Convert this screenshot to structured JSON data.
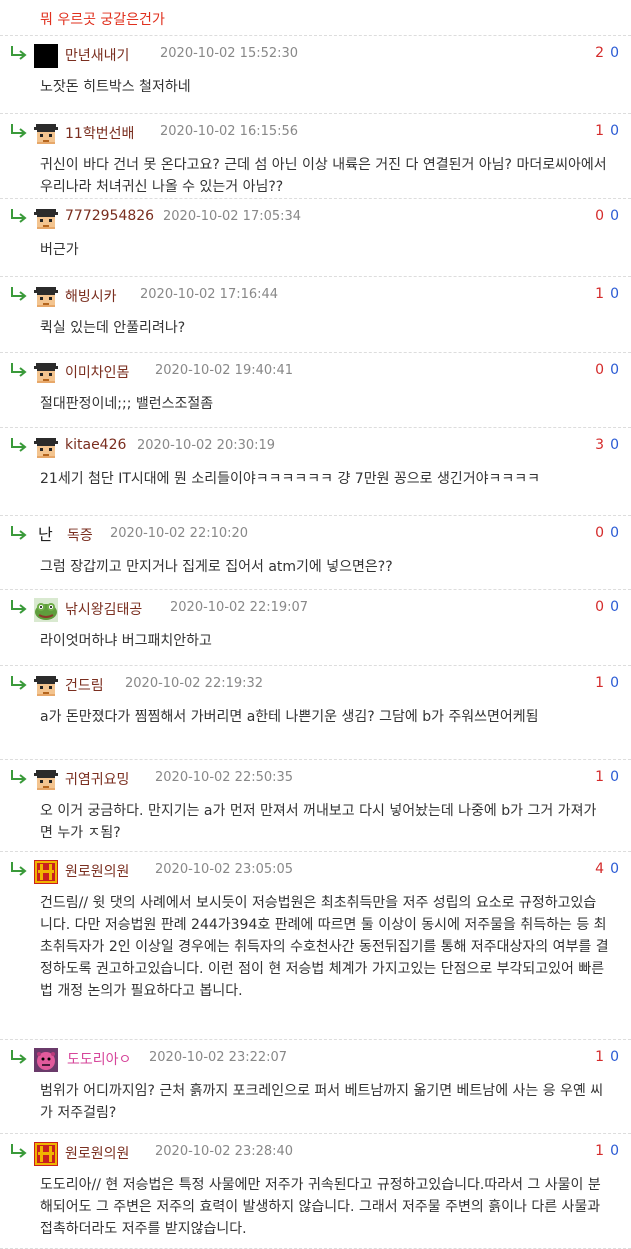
{
  "top_text": "뭐 우르곳 궁갈은건가",
  "comments": [
    {
      "nick": "만년새내기",
      "date": "2020-10-02 15:52:30",
      "up": "2",
      "down": "0",
      "avatar": "black",
      "text": "노잣돈 히트박스 철저하네"
    },
    {
      "nick": "11학번선배",
      "date": "2020-10-02 16:15:56",
      "up": "1",
      "down": "0",
      "avatar": "pixel-face",
      "text": "귀신이 바다 건너 못 온다고요? 근데 섬 아닌 이상 내륙은 거진 다 연결된거 아님? 마더로씨아에서 우리나라 처녀귀신 나올 수 있는거 아님??"
    },
    {
      "nick": "7772954826",
      "date": "2020-10-02 17:05:34",
      "up": "0",
      "down": "0",
      "avatar": "pixel-face",
      "text": "버근가"
    },
    {
      "nick": "해빙시카",
      "date": "2020-10-02 17:16:44",
      "up": "1",
      "down": "0",
      "avatar": "pixel-face",
      "text": "퀵실 있는데 안풀리려나?"
    },
    {
      "nick": "이미차인몸",
      "date": "2020-10-02 19:40:41",
      "up": "0",
      "down": "0",
      "avatar": "pixel-face",
      "text": "절대판정이네;;; 밸런스조절좀"
    },
    {
      "nick": "kitae426",
      "date": "2020-10-02 20:30:19",
      "up": "3",
      "down": "0",
      "avatar": "pixel-face",
      "text": "21세기 첨단 IT시대에 뭔 소리들이야ㅋㅋㅋㅋㅋㅋ 걍 7만원 꽁으로 생긴거야ㅋㅋㅋㅋ"
    },
    {
      "nick": "독증",
      "date": "2020-10-02 22:10:20",
      "up": "0",
      "down": "0",
      "avatar": "text",
      "avatar_text": "난",
      "text": "그럼 장갑끼고 만지거나 집게로 집어서 atm기에 넣으면은??"
    },
    {
      "nick": "낚시왕김태공",
      "date": "2020-10-02 22:19:07",
      "up": "0",
      "down": "0",
      "avatar": "frog",
      "text": "라이엇머하냐 버그패치안하고"
    },
    {
      "nick": "건드림",
      "date": "2020-10-02 22:19:32",
      "up": "1",
      "down": "0",
      "avatar": "pixel-face",
      "text": "a가 돈만졌다가 찜찜해서 가버리면 a한테 나쁜기운 생김? 그담에 b가 주워쓰면어케됨"
    },
    {
      "nick": "귀염귀요밍",
      "date": "2020-10-02 22:50:35",
      "up": "1",
      "down": "0",
      "avatar": "pixel-face",
      "text": "오 이거 궁금하다. 만지기는 a가 먼저 만져서 꺼내보고 다시 넣어놨는데 나중에 b가 그거 가져가면 누가 ㅈ됨?"
    },
    {
      "nick": "원로원의원",
      "date": "2020-10-02 23:05:05",
      "up": "4",
      "down": "0",
      "avatar": "emblem",
      "text": "건드림// 윗 댓의 사례에서 보시듯이 저승법원은 최초취득만을 저주 성립의 요소로 규정하고있습니다. 다만 저승법원 판례 244가394호 판례에 따르면 둘 이상이 동시에 저주물을 취득하는 등 최초취득자가 2인 이상일 경우에는 취득자의 수호천사간 동전뒤집기를 통해 저주대상자의 여부를 결정하도록 권고하고있습니다. 이런 점이 현 저승법 체계가 가지고있는 단점으로 부각되고있어 빠른 법 개정 논의가 필요하다고 봅니다."
    },
    {
      "nick": "도도리아ㅇ",
      "date": "2020-10-02 23:22:07",
      "up": "1",
      "down": "0",
      "avatar": "dodoria",
      "pink": true,
      "text": "범위가 어디까지임? 근처 흙까지 포크레인으로 퍼서 베트남까지 옮기면 베트남에 사는 응 우옌 씨가 저주걸림?"
    },
    {
      "nick": "원로원의원",
      "date": "2020-10-02 23:28:40",
      "up": "1",
      "down": "0",
      "avatar": "emblem",
      "text": "도도리아// 현 저승법은 특정 사물에만 저주가 귀속된다고 규정하고있습니다.따라서 그 사물이 분해되어도 그 주변은 저주의 효력이 발생하지 않습니다. 그래서 저주물 주변의 흙이나 다른 사물과 접촉하더라도 저주를 받지않습니다."
    }
  ]
}
